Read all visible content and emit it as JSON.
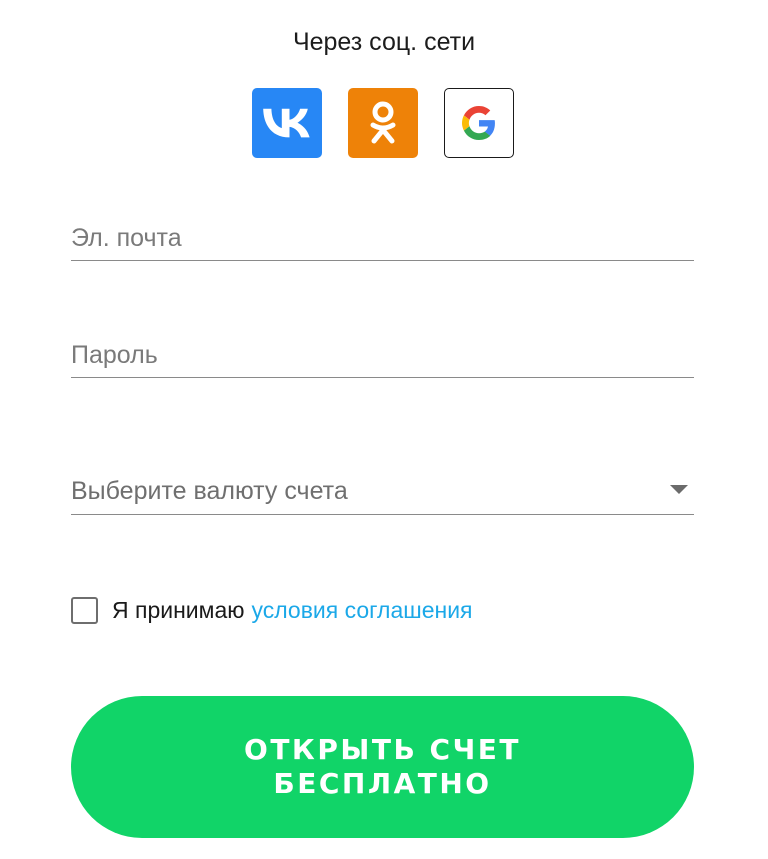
{
  "social": {
    "title": "Через соц. сети",
    "buttons": [
      {
        "name": "vk",
        "icon": "vk-icon",
        "color": "#2787f5"
      },
      {
        "name": "ok",
        "icon": "odnoklassniki-icon",
        "color": "#ee8208"
      },
      {
        "name": "google",
        "icon": "google-icon",
        "color": "#ffffff"
      }
    ]
  },
  "form": {
    "email_placeholder": "Эл. почта",
    "email_value": "",
    "password_placeholder": "Пароль",
    "password_value": "",
    "currency_placeholder": "Выберите валюту счета",
    "agree_text": "Я принимаю",
    "agree_link": "условия соглашения",
    "agree_checked": false
  },
  "cta": {
    "label": "ОТКРЫТЬ СЧЕТ БЕСПЛАТНО",
    "color": "#11d468"
  }
}
